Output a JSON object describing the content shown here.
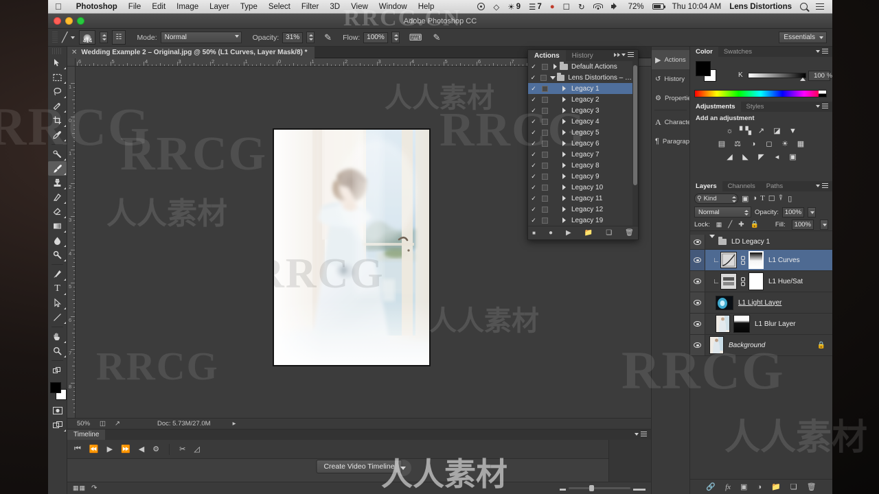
{
  "menubar": {
    "apple": "apple-logo",
    "items": [
      {
        "label": "Photoshop",
        "bold": true
      },
      {
        "label": "File"
      },
      {
        "label": "Edit"
      },
      {
        "label": "Image"
      },
      {
        "label": "Layer"
      },
      {
        "label": "Type"
      },
      {
        "label": "Select"
      },
      {
        "label": "Filter"
      },
      {
        "label": "3D"
      },
      {
        "label": "View"
      },
      {
        "label": "Window"
      },
      {
        "label": "Help"
      }
    ],
    "status_items": [
      {
        "icon": "record-circle-icon",
        "label": ""
      },
      {
        "icon": "dropbox-icon",
        "label": ""
      },
      {
        "icon": "globe-badge-icon",
        "label": "9"
      },
      {
        "icon": "activity-icon",
        "label": "7"
      },
      {
        "icon": "red-dot-icon",
        "label": ""
      },
      {
        "icon": "airplay-icon",
        "label": ""
      },
      {
        "icon": "timemachine-icon",
        "label": ""
      }
    ],
    "wifi": "wifi-icon",
    "volume": "volume-icon",
    "battery_percent": "72%",
    "clock": "Thu 10:04 AM",
    "user": "Lens Distortions",
    "search": "spotlight-search-icon",
    "notifications": "notification-center-icon"
  },
  "window": {
    "title": "Adobe Photoshop CC"
  },
  "options_bar": {
    "tool_icon": "brush-tool-icon",
    "brush_size": "414",
    "brush_preset_icon": "brush-preset-picker-icon",
    "airbrush_icon": "airbrush-icon",
    "mode_label": "Mode:",
    "mode_value": "Normal",
    "opacity_label": "Opacity:",
    "opacity_value": "31%",
    "flow_label": "Flow:",
    "flow_value": "100%",
    "pressure_opacity_icon": "tablet-pressure-opacity-icon",
    "pressure_size_icon": "tablet-pressure-size-icon",
    "smoothing_icon": "smoothing-icon",
    "workspace": "Essentials"
  },
  "toolbox": {
    "tools": [
      {
        "name": "move-tool",
        "glyph": "move"
      },
      {
        "name": "marquee-tool",
        "glyph": "marquee"
      },
      {
        "name": "lasso-tool",
        "glyph": "lasso"
      },
      {
        "name": "quick-selection-tool",
        "glyph": "quickselect"
      },
      {
        "name": "crop-tool",
        "glyph": "crop"
      },
      {
        "name": "eyedropper-tool",
        "glyph": "eyedropper"
      },
      {
        "name": "healing-brush-tool",
        "glyph": "heal"
      },
      {
        "name": "brush-tool",
        "glyph": "brush",
        "active": true
      },
      {
        "name": "clone-stamp-tool",
        "glyph": "stamp"
      },
      {
        "name": "history-brush-tool",
        "glyph": "historybrush"
      },
      {
        "name": "eraser-tool",
        "glyph": "eraser"
      },
      {
        "name": "gradient-tool",
        "glyph": "gradient"
      },
      {
        "name": "blur-tool",
        "glyph": "blur"
      },
      {
        "name": "dodge-tool",
        "glyph": "dodge"
      },
      {
        "name": "pen-tool",
        "glyph": "pen"
      },
      {
        "name": "type-tool",
        "glyph": "T"
      },
      {
        "name": "path-selection-tool",
        "glyph": "pathselect"
      },
      {
        "name": "line-tool",
        "glyph": "line"
      },
      {
        "name": "hand-tool",
        "glyph": "hand"
      },
      {
        "name": "zoom-tool",
        "glyph": "zoom"
      }
    ],
    "foreground_color": "#000000",
    "background_color": "#ffffff",
    "quick_mask": "quick-mask-icon",
    "screen_mode": "screen-mode-icon"
  },
  "document": {
    "tab_title": "Wedding Example 2 – Original.jpg @ 50% (L1 Curves, Layer Mask/8) *",
    "close_icon": "close-tab-icon",
    "ruler_h": [
      "6",
      "5",
      "4",
      "3",
      "2",
      "1",
      "0",
      "1",
      "2",
      "3",
      "4",
      "5",
      "6",
      "7"
    ],
    "ruler_v": [
      "1",
      "0",
      "1",
      "2",
      "3",
      "4",
      "5",
      "6",
      "7",
      "8"
    ]
  },
  "status_bar": {
    "zoom": "50%",
    "doc_icon_1": "document-dimensions-icon",
    "doc_icon_2": "share-icon",
    "doc_size": "Doc: 5.73M/27.0M",
    "expand_icon": "status-expand-arrow-icon"
  },
  "timeline": {
    "tab": "Timeline",
    "transport": [
      {
        "name": "go-to-first-frame-button",
        "glyph": "first"
      },
      {
        "name": "previous-frame-button",
        "glyph": "prev"
      },
      {
        "name": "play-button",
        "glyph": "play"
      },
      {
        "name": "next-frame-button",
        "glyph": "next"
      },
      {
        "name": "audio-button",
        "glyph": "audio"
      },
      {
        "name": "settings-button",
        "glyph": "gear"
      },
      {
        "name": "split-at-playhead-button",
        "glyph": "scissors"
      },
      {
        "name": "transition-button",
        "glyph": "transition"
      }
    ],
    "create_button": "Create Video Timeline",
    "create_dropdown_icon": "chevron-down-icon",
    "foot_icons": [
      "frame-view-icon",
      "onion-skin-icon",
      "delete-icon",
      "convert-to-frames-icon"
    ]
  },
  "actions_panel": {
    "tabs": [
      {
        "label": "Actions",
        "selected": true
      },
      {
        "label": "History",
        "selected": false
      }
    ],
    "collapse_icon": "collapse-double-arrow-icon",
    "menu_icon": "panel-menu-icon",
    "rows": [
      {
        "label": "Default Actions",
        "type": "folder",
        "expanded": false,
        "checked": true
      },
      {
        "label": "Lens Distortions – Le...",
        "type": "folder",
        "expanded": true,
        "checked": true
      },
      {
        "label": "Legacy 1",
        "type": "action",
        "checked": true,
        "selected": true
      },
      {
        "label": "Legacy 2",
        "type": "action",
        "checked": true
      },
      {
        "label": "Legacy 3",
        "type": "action",
        "checked": true
      },
      {
        "label": "Legacy 4",
        "type": "action",
        "checked": true
      },
      {
        "label": "Legacy 5",
        "type": "action",
        "checked": true
      },
      {
        "label": "Legacy 6",
        "type": "action",
        "checked": true
      },
      {
        "label": "Legacy 7",
        "type": "action",
        "checked": true
      },
      {
        "label": "Legacy 8",
        "type": "action",
        "checked": true
      },
      {
        "label": "Legacy 9",
        "type": "action",
        "checked": true
      },
      {
        "label": "Legacy 10",
        "type": "action",
        "checked": true
      },
      {
        "label": "Legacy 11",
        "type": "action",
        "checked": true
      },
      {
        "label": "Legacy 12",
        "type": "action",
        "checked": true
      },
      {
        "label": "Legacy 19",
        "type": "action",
        "checked": true
      }
    ],
    "footer_icons": [
      "stop-button",
      "record-button",
      "play-button",
      "new-set-button",
      "new-action-button",
      "delete-button"
    ]
  },
  "dock_icons": [
    {
      "label": "Actions",
      "icon": "play-triangle-icon",
      "selected": true
    },
    {
      "label": "History",
      "icon": "history-icon",
      "selected": false
    },
    {
      "label": "Properties",
      "icon": "properties-icon",
      "selected": false
    },
    {
      "label": "Character",
      "icon": "character-icon",
      "selected": false
    },
    {
      "label": "Paragraph",
      "icon": "paragraph-icon",
      "selected": false
    }
  ],
  "color_panel": {
    "tabs": [
      {
        "label": "Color",
        "selected": true
      },
      {
        "label": "Swatches",
        "selected": false
      }
    ],
    "menu_icon": "panel-menu-icon",
    "channel_label": "K",
    "channel_value": "100",
    "channel_unit": "%",
    "foreground": "#000000",
    "background": "#ffffff"
  },
  "adjustments_panel": {
    "tabs": [
      {
        "label": "Adjustments",
        "selected": true
      },
      {
        "label": "Styles",
        "selected": false
      }
    ],
    "menu_icon": "panel-menu-icon",
    "heading": "Add an adjustment",
    "row1": [
      "brightness-contrast-icon",
      "levels-icon",
      "curves-icon",
      "exposure-icon",
      "vibrance-icon"
    ],
    "row2": [
      "hue-saturation-icon",
      "color-balance-icon",
      "black-white-icon",
      "photo-filter-icon",
      "channel-mixer-icon",
      "color-lookup-icon"
    ],
    "row3": [
      "invert-icon",
      "posterize-icon",
      "threshold-icon",
      "gradient-map-icon",
      "selective-color-icon"
    ]
  },
  "layers_panel": {
    "tabs": [
      {
        "label": "Layers",
        "selected": true
      },
      {
        "label": "Channels",
        "selected": false
      },
      {
        "label": "Paths",
        "selected": false
      }
    ],
    "menu_icon": "panel-menu-icon",
    "filter_label": "Kind",
    "filter_icon": "search-icon",
    "filter_types": [
      "pixel-filter-icon",
      "adjustment-filter-icon",
      "type-filter-icon",
      "shape-filter-icon",
      "smartobject-filter-icon"
    ],
    "filter_toggle": "filter-toggle-icon",
    "blend_mode": "Normal",
    "opacity_label": "Opacity:",
    "opacity_value": "100%",
    "lock_label": "Lock:",
    "lock_icons": [
      "lock-transparency-icon",
      "lock-image-icon",
      "lock-position-icon",
      "lock-all-icon"
    ],
    "fill_label": "Fill:",
    "fill_value": "100%",
    "layers": [
      {
        "name": "LD Legacy 1",
        "type": "group",
        "expanded": true,
        "visible": true
      },
      {
        "name": "L1 Curves",
        "type": "adjustment-curves",
        "visible": true,
        "selected": true,
        "clipped": true,
        "linked": true,
        "has_mask": true,
        "mask_active": true
      },
      {
        "name": "L1 Hue/Sat",
        "type": "adjustment-huesat",
        "visible": true,
        "clipped": true,
        "linked": true,
        "has_mask": true
      },
      {
        "name": "L1 Light Layer",
        "type": "pixel",
        "visible": true,
        "underline": true
      },
      {
        "name": "L1 Blur Layer",
        "type": "pixel",
        "visible": true,
        "has_mask": true
      },
      {
        "name": "Background",
        "type": "background",
        "visible": true,
        "locked": true,
        "italic": true
      }
    ],
    "footer_icons": [
      "link-layers-icon",
      "layer-style-fx-icon",
      "add-mask-icon",
      "new-adjustment-icon",
      "new-group-icon",
      "new-layer-icon",
      "delete-layer-icon"
    ]
  },
  "watermarks": [
    "RRCG.CN",
    "RRCG",
    "人人素材",
    "人人素材"
  ]
}
